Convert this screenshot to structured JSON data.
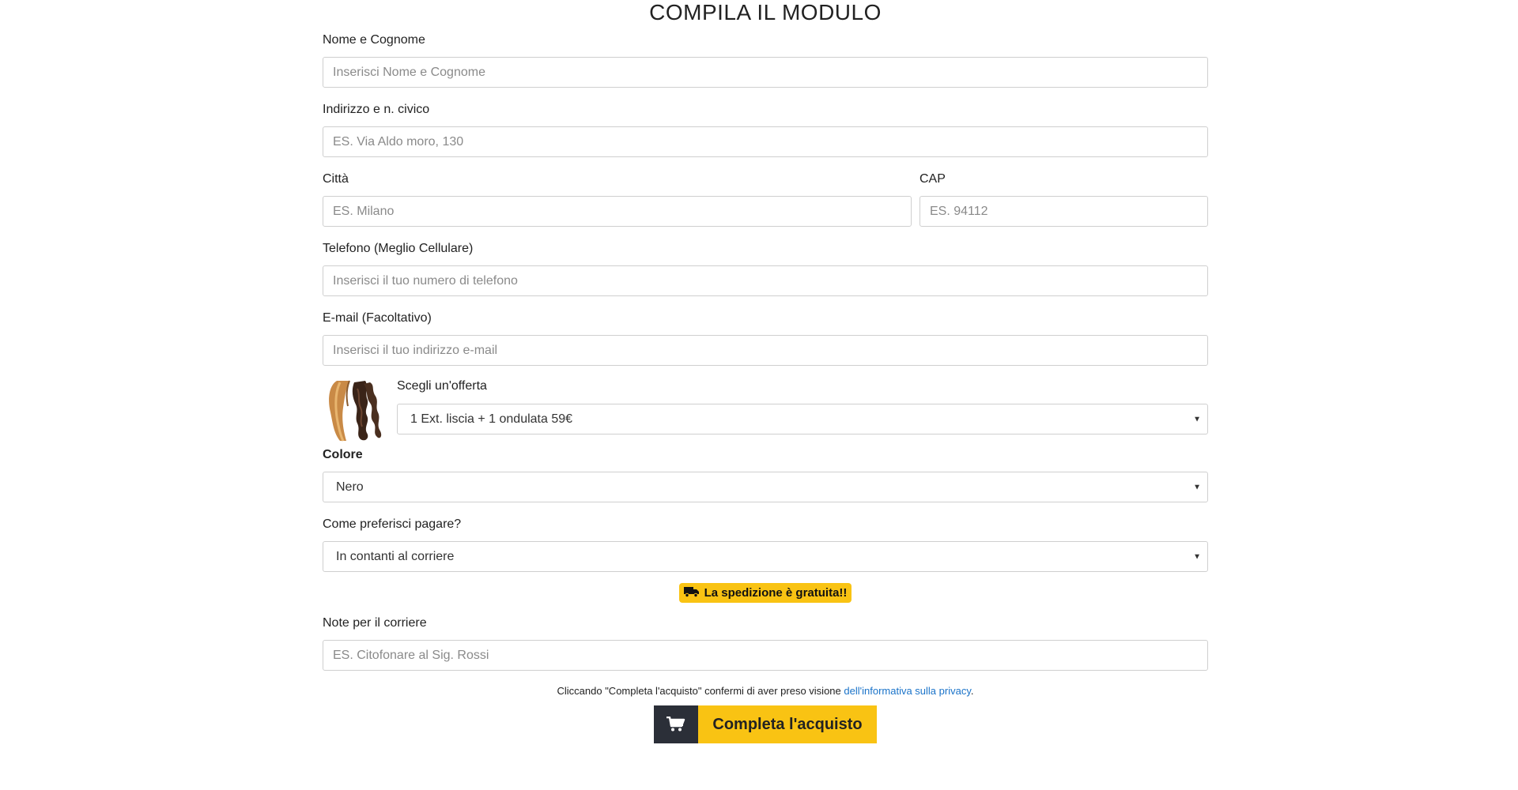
{
  "form": {
    "title": "COMPILA IL MODULO",
    "name": {
      "label": "Nome e Cognome",
      "placeholder": "Inserisci Nome e Cognome"
    },
    "address": {
      "label": "Indirizzo e n. civico",
      "placeholder": "ES. Via Aldo moro, 130"
    },
    "city": {
      "label": "Città",
      "placeholder": "ES. Milano"
    },
    "cap": {
      "label": "CAP",
      "placeholder": "ES. 94112"
    },
    "phone": {
      "label": "Telefono (Meglio Cellulare)",
      "placeholder": "Inserisci il tuo numero di telefono"
    },
    "email": {
      "label": "E-mail (Facoltativo)",
      "placeholder": "Inserisci il tuo indirizzo e-mail"
    },
    "offer": {
      "label": "Scegli un'offerta",
      "selected": "1 Ext. liscia + 1 ondulata 59€"
    },
    "color": {
      "label": "Colore",
      "selected": "Nero"
    },
    "payment": {
      "label": "Come preferisci pagare?",
      "selected": "In contanti al corriere"
    },
    "shipping_badge": "La spedizione è gratuita!!",
    "notes": {
      "label": "Note per il corriere",
      "placeholder": "ES. Citofonare al Sig. Rossi"
    },
    "consent": {
      "text": "Cliccando \"Completa l'acquisto\" confermi di aver preso visione ",
      "link": "dell'informativa sulla privacy",
      "end": "."
    },
    "submit_label": "Completa l'acquisto"
  },
  "icons": {
    "badge_icon": "truck-icon",
    "submit_icon": "cart-icon",
    "select_caret": "caret-down-icon",
    "offer_image": "hair-extension-image"
  },
  "colors": {
    "accent_yellow": "#f9c313",
    "dark_button": "#2b2f38",
    "link_blue": "#1a73c9",
    "input_border": "#cfcfcf"
  }
}
